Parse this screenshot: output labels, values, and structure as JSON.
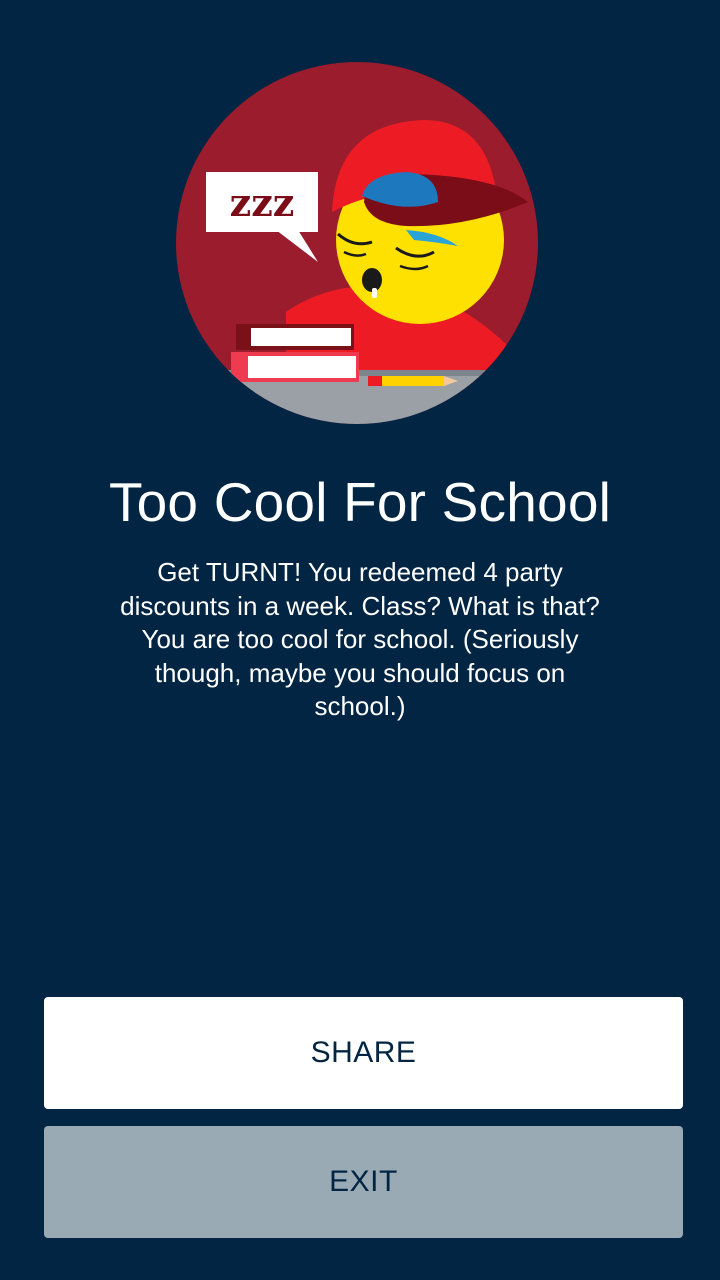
{
  "achievement": {
    "title": "Too Cool For School",
    "description": "Get TURNT! You redeemed 4 party discounts in a week. Class? What is that? You are too cool for school. (Seriously though, maybe you should focus on school.)",
    "badge_icon": "sleeping-emoji-cap-badge",
    "speech_text": "zzz"
  },
  "actions": {
    "share_label": "SHARE",
    "exit_label": "EXIT"
  },
  "colors": {
    "background": "#022543",
    "badge_circle": "#9b1c2c",
    "cap_red": "#ed1c24",
    "face_yellow": "#ffe100",
    "exit_button": "#9aaab4"
  }
}
